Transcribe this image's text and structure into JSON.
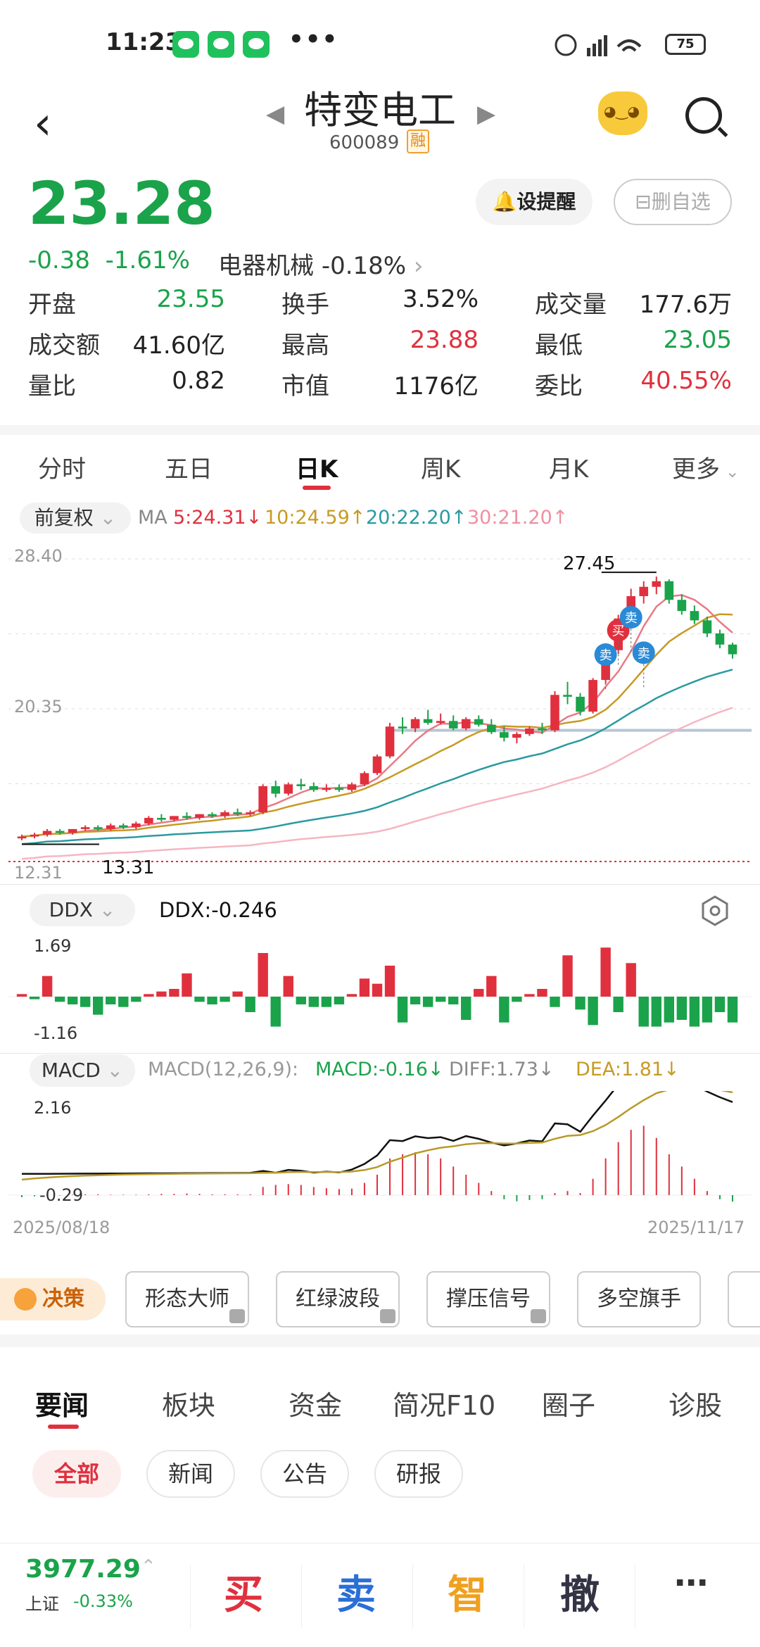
{
  "status": {
    "time": "11:23",
    "battery": "75"
  },
  "header": {
    "name": "特变电工",
    "code": "600089",
    "margin_badge": "融"
  },
  "quote": {
    "price": "23.28",
    "change": "-0.38",
    "change_pct": "-1.61%",
    "sector_name": "电器机械",
    "sector_pct": "-0.18%",
    "alert_label": "设提醒",
    "remove_label": "删自选"
  },
  "stats": [
    [
      {
        "label": "开盘",
        "value": "23.55",
        "color": "green"
      },
      {
        "label": "换手",
        "value": "3.52%",
        "color": "black"
      },
      {
        "label": "成交量",
        "value": "177.6万",
        "color": "black"
      }
    ],
    [
      {
        "label": "成交额",
        "value": "41.60亿",
        "color": "black"
      },
      {
        "label": "最高",
        "value": "23.88",
        "color": "red"
      },
      {
        "label": "最低",
        "value": "23.05",
        "color": "green"
      }
    ],
    [
      {
        "label": "量比",
        "value": "0.82",
        "color": "black"
      },
      {
        "label": "市值",
        "value": "1176亿",
        "color": "black"
      },
      {
        "label": "委比",
        "value": "40.55%",
        "color": "red"
      }
    ]
  ],
  "chart_tabs": [
    "分时",
    "五日",
    "日K",
    "周K",
    "月K",
    "更多"
  ],
  "ma": {
    "adjust": "前复权",
    "label": "MA",
    "ma5": "5:24.31↓",
    "ma10": "10:24.59↑",
    "ma20": "20:22.20↑",
    "ma30": "30:21.20↑"
  },
  "kline": {
    "y_top": "28.40",
    "y_mid": "20.35",
    "y_bottom": "12.31",
    "high_label": "27.45",
    "low_label": "13.31",
    "buy_label": "买",
    "sell_label": "卖",
    "date_start": "2025/08/18",
    "date_end": "2025/11/17"
  },
  "ddx": {
    "name": "DDX",
    "value_label": "DDX:-0.246",
    "y_top": "1.69",
    "y_bottom": "-1.16"
  },
  "macd": {
    "name": "MACD",
    "params": "MACD(12,26,9):",
    "macd": "MACD:-0.16↓",
    "diff": "DIFF:1.73↓",
    "dea": "DEA:1.81↓",
    "y_top": "2.16",
    "y_bottom": "-0.29"
  },
  "tools": {
    "decision": "决策",
    "chips": [
      "形态大师",
      "红绿波段",
      "撑压信号",
      "多空旗手"
    ]
  },
  "news_tabs": [
    "要闻",
    "板块",
    "资金",
    "简况F10",
    "圈子",
    "诊股"
  ],
  "filters": [
    "全部",
    "新闻",
    "公告",
    "研报"
  ],
  "bottom": {
    "index_value": "3977.29",
    "index_name": "上证",
    "index_pct": "-0.33%",
    "buy": "买",
    "sell": "卖",
    "smart": "智",
    "cancel": "撤",
    "more": "⋯"
  },
  "chart_data": {
    "type": "candlestick",
    "x_range": [
      "2025/08/18",
      "2025/11/17"
    ],
    "ylim": [
      12.31,
      28.4
    ],
    "ohlc": [
      [
        13.4,
        13.6,
        13.3,
        13.5
      ],
      [
        13.5,
        13.7,
        13.4,
        13.6
      ],
      [
        13.6,
        13.9,
        13.5,
        13.8
      ],
      [
        13.8,
        13.9,
        13.6,
        13.7
      ],
      [
        13.7,
        13.9,
        13.6,
        13.9
      ],
      [
        13.9,
        14.1,
        13.8,
        14.0
      ],
      [
        14.0,
        14.1,
        13.8,
        13.9
      ],
      [
        13.9,
        14.2,
        13.8,
        14.1
      ],
      [
        14.1,
        14.2,
        13.9,
        14.0
      ],
      [
        14.0,
        14.3,
        13.9,
        14.2
      ],
      [
        14.2,
        14.6,
        14.1,
        14.5
      ],
      [
        14.5,
        14.7,
        14.3,
        14.4
      ],
      [
        14.4,
        14.6,
        14.3,
        14.6
      ],
      [
        14.6,
        14.8,
        14.4,
        14.5
      ],
      [
        14.5,
        14.7,
        14.4,
        14.7
      ],
      [
        14.7,
        14.8,
        14.5,
        14.6
      ],
      [
        14.6,
        14.9,
        14.5,
        14.8
      ],
      [
        14.8,
        15.0,
        14.6,
        14.7
      ],
      [
        14.7,
        14.9,
        14.6,
        14.8
      ],
      [
        14.8,
        16.3,
        14.7,
        16.2
      ],
      [
        16.2,
        16.5,
        15.6,
        15.8
      ],
      [
        15.8,
        16.4,
        15.7,
        16.3
      ],
      [
        16.3,
        16.6,
        16.0,
        16.2
      ],
      [
        16.2,
        16.4,
        15.9,
        16.0
      ],
      [
        16.0,
        16.3,
        15.9,
        16.1
      ],
      [
        16.1,
        16.3,
        15.9,
        16.0
      ],
      [
        16.0,
        16.4,
        15.9,
        16.3
      ],
      [
        16.3,
        17.0,
        16.2,
        16.9
      ],
      [
        16.9,
        17.9,
        16.8,
        17.8
      ],
      [
        17.8,
        19.6,
        17.7,
        19.4
      ],
      [
        19.4,
        19.9,
        19.0,
        19.3
      ],
      [
        19.3,
        19.9,
        19.1,
        19.8
      ],
      [
        19.8,
        20.3,
        19.5,
        19.6
      ],
      [
        19.6,
        20.1,
        19.5,
        19.7
      ],
      [
        19.7,
        20.0,
        19.2,
        19.3
      ],
      [
        19.3,
        19.9,
        19.2,
        19.8
      ],
      [
        19.8,
        20.0,
        19.4,
        19.5
      ],
      [
        19.5,
        19.8,
        19.0,
        19.1
      ],
      [
        19.1,
        19.4,
        18.6,
        18.8
      ],
      [
        18.8,
        19.1,
        18.5,
        19.0
      ],
      [
        19.0,
        19.4,
        18.9,
        19.3
      ],
      [
        19.3,
        19.6,
        19.0,
        19.2
      ],
      [
        19.2,
        21.3,
        19.1,
        21.1
      ],
      [
        21.1,
        21.8,
        20.6,
        21.0
      ],
      [
        21.0,
        21.2,
        20.0,
        20.2
      ],
      [
        20.2,
        22.0,
        20.1,
        21.9
      ],
      [
        21.9,
        23.7,
        21.7,
        23.5
      ],
      [
        23.5,
        25.4,
        23.3,
        25.2
      ],
      [
        25.2,
        26.8,
        25.0,
        26.4
      ],
      [
        26.4,
        27.2,
        26.0,
        26.9
      ],
      [
        26.9,
        27.45,
        26.5,
        27.2
      ],
      [
        27.2,
        27.3,
        26.0,
        26.2
      ],
      [
        26.2,
        26.5,
        25.4,
        25.6
      ],
      [
        25.6,
        25.9,
        24.9,
        25.1
      ],
      [
        25.1,
        25.3,
        24.2,
        24.4
      ],
      [
        24.4,
        24.6,
        23.6,
        23.8
      ],
      [
        23.8,
        23.9,
        23.05,
        23.28
      ]
    ],
    "ma5_label": "5:24.31",
    "ma10_label": "10:24.59",
    "ma20_label": "20:22.20",
    "ma30_label": "30:21.20",
    "high": 27.45,
    "low": 13.31,
    "ddx_values": [
      0.1,
      -0.1,
      0.8,
      -0.2,
      -0.3,
      -0.4,
      -0.7,
      -0.3,
      -0.4,
      -0.2,
      0.1,
      0.2,
      0.3,
      0.9,
      -0.2,
      -0.3,
      -0.2,
      0.2,
      -0.6,
      1.69,
      -1.16,
      0.8,
      -0.3,
      -0.4,
      -0.4,
      -0.3,
      0.1,
      0.7,
      0.5,
      1.2,
      -1.0,
      -0.3,
      -0.4,
      -0.2,
      -0.3,
      -0.9,
      0.3,
      0.8,
      -1.0,
      -0.2,
      0.1,
      0.3,
      -0.4,
      1.6,
      -0.5,
      -1.1,
      1.9,
      -0.6,
      1.3,
      -1.16,
      -1.16,
      -1.0,
      -0.9,
      -1.16,
      -1.0,
      -0.6,
      -1.0
    ],
    "macd_hist": [
      -0.05,
      -0.03,
      -0.02,
      -0.01,
      0.01,
      0.02,
      0.02,
      0.01,
      0.01,
      0.01,
      0.02,
      0.03,
      0.03,
      0.04,
      0.03,
      0.02,
      0.02,
      0.02,
      0.02,
      0.2,
      0.25,
      0.27,
      0.25,
      0.2,
      0.17,
      0.15,
      0.16,
      0.3,
      0.5,
      0.9,
      1.0,
      1.05,
      1.0,
      0.9,
      0.7,
      0.5,
      0.3,
      0.1,
      -0.1,
      -0.15,
      -0.12,
      -0.1,
      0.05,
      0.1,
      0.05,
      0.4,
      0.9,
      1.3,
      1.6,
      1.7,
      1.4,
      1.0,
      0.7,
      0.4,
      0.1,
      -0.1,
      -0.16
    ]
  }
}
